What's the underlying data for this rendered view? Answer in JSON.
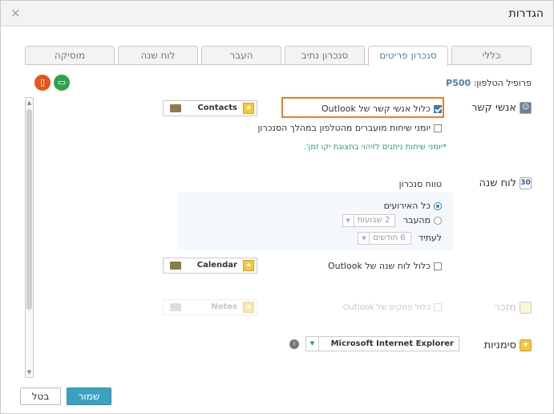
{
  "window": {
    "title": "הגדרות",
    "close_symbol": "×"
  },
  "tabs": [
    {
      "label": "כללי",
      "active": false
    },
    {
      "label": "סנכרון פריטים",
      "active": true
    },
    {
      "label": "סנכרון נתיב",
      "active": false
    },
    {
      "label": "העבר",
      "active": false
    },
    {
      "label": "לוח שנה",
      "active": false
    },
    {
      "label": "מוסיקה",
      "active": false
    }
  ],
  "profile": {
    "label": "פרופיל הטלפון:",
    "value": "P500",
    "phone_icon": "phone-icon",
    "computer_icon": "computer-icon"
  },
  "contacts": {
    "label": "אנשי קשר",
    "include_outlook_label": "כלול אנשי קשר של Outlook",
    "include_outlook_checked": true,
    "folder": "Contacts",
    "birthdays_label": "יומני שיחות מועברים מהטלפון במהלך הסנכרון",
    "birthdays_checked": false,
    "note": "*יומני שיחות ניתנים לזיהוי בתצוגת יקו זמן'."
  },
  "calendar": {
    "label": "לוח שנה",
    "icon_day": "30",
    "range_title": "טווח סנכרון",
    "all_events_label": "כל האירועים",
    "past_label": "מהעבר",
    "past_value": "2 שבועות",
    "future_label": "לעתיד",
    "future_value": "6 חודשים",
    "include_outlook_label": "כלול לוח שנה של Outlook",
    "include_outlook_checked": false,
    "folder": "Calendar"
  },
  "notes": {
    "label": "מזכר",
    "include_outlook_label": "כלול פתקים של Outlook",
    "folder": "Notes"
  },
  "bookmarks": {
    "label": "סימניות",
    "browser": "Microsoft Internet Explorer"
  },
  "footer": {
    "save_label": "שמור",
    "cancel_label": "בטל"
  },
  "colors": {
    "accent": "#3aa2c0",
    "highlight": "#f07b27",
    "note_text": "#2a9b6f",
    "phone_circle": "#e8541e",
    "computer_circle": "#2fa34a"
  }
}
